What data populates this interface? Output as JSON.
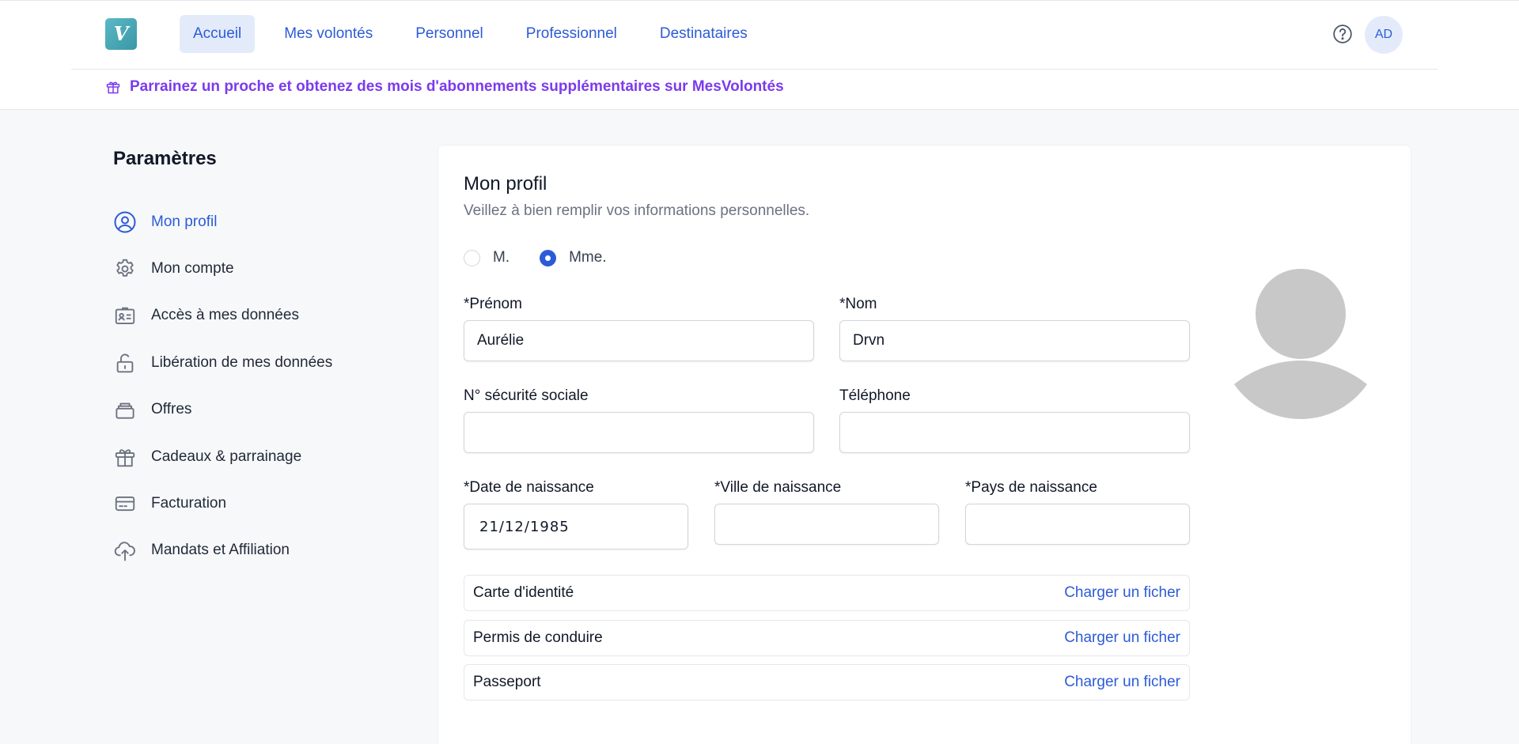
{
  "header": {
    "logo_letter": "V",
    "nav": [
      {
        "label": "Accueil",
        "active": true
      },
      {
        "label": "Mes volontés",
        "active": false
      },
      {
        "label": "Personnel",
        "active": false
      },
      {
        "label": "Professionnel",
        "active": false
      },
      {
        "label": "Destinataires",
        "active": false
      }
    ],
    "help_icon": "question-circle-icon",
    "avatar_initials": "AD"
  },
  "promo": {
    "icon": "gift-icon",
    "text": "Parrainez un proche et obtenez des mois d'abonnements supplémentaires sur MesVolontés",
    "color": "#7c3aed"
  },
  "sidebar": {
    "title": "Paramètres",
    "items": [
      {
        "label": "Mon profil",
        "icon": "user-circle-icon",
        "active": true
      },
      {
        "label": "Mon compte",
        "icon": "gear-icon",
        "active": false
      },
      {
        "label": "Accès à mes données",
        "icon": "id-card-icon",
        "active": false
      },
      {
        "label": "Libération de mes données",
        "icon": "lock-open-icon",
        "active": false
      },
      {
        "label": "Offres",
        "icon": "stack-icon",
        "active": false
      },
      {
        "label": "Cadeaux & parrainage",
        "icon": "gift-icon",
        "active": false
      },
      {
        "label": "Facturation",
        "icon": "credit-card-icon",
        "active": false
      },
      {
        "label": "Mandats et Affiliation",
        "icon": "cloud-upload-icon",
        "active": false
      }
    ]
  },
  "profile": {
    "title": "Mon profil",
    "subtitle": "Veillez à bien remplir vos informations personnelles.",
    "civility": {
      "options": [
        "M.",
        "Mme."
      ],
      "selected": "Mme."
    },
    "fields": {
      "prenom": {
        "label": "*Prénom",
        "value": "Aurélie"
      },
      "nom": {
        "label": "*Nom",
        "value": "Drvn"
      },
      "secu": {
        "label": "N° sécurité sociale",
        "value": ""
      },
      "telephone": {
        "label": "Téléphone",
        "value": ""
      },
      "date_naissance": {
        "label": "*Date de naissance",
        "value": "21/12/1985"
      },
      "ville_naissance": {
        "label": "*Ville de naissance",
        "value": ""
      },
      "pays_naissance": {
        "label": "*Pays de naissance",
        "value": ""
      }
    },
    "documents": [
      {
        "label": "Carte d'identité",
        "action": "Charger un ficher"
      },
      {
        "label": "Permis de conduire",
        "action": "Charger un ficher"
      },
      {
        "label": "Passeport",
        "action": "Charger un ficher"
      }
    ]
  },
  "colors": {
    "accent": "#2c5bd8",
    "accent_bg": "#e3ebfb",
    "promo": "#7c3aed"
  }
}
